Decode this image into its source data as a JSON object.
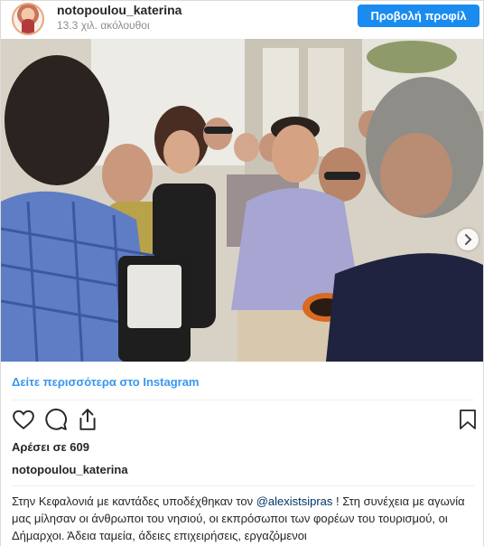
{
  "header": {
    "username": "notopoulou_katerina",
    "followers": "13.3 χιλ. ακόλουθοι",
    "profile_button": "Προβολή προφίλ"
  },
  "post": {
    "image_alt_icon": "photo",
    "carousel": {
      "slide_count": 4,
      "active_index": 0
    },
    "next_icon": "chevron-right-icon",
    "more_link": "Δείτε περισσότερα στο Instagram",
    "actions": [
      "heart-icon",
      "comment-icon",
      "share-icon",
      "bookmark-icon"
    ],
    "likes": "Αρέσει σε 609",
    "caption_user": "notopoulou_katerina",
    "caption": {
      "part1": "Στην Κεφαλονιά με καντάδες υποδέχθηκαν τον ",
      "mention": "@alexistsipras",
      "part2": " ! Στη συνέχεια με αγωνία μας μίλησαν οι άνθρωποι του νησιού, οι εκπρόσωποι των φορέων του τουρισμού, οι Δήμαρχοι. Άδεια ταμεία, άδειες επιχειρήσεις, εργαζόμενοι"
    }
  },
  "colors": {
    "accent": "#3897f0",
    "button": "#1a8cf0",
    "mention": "#003569"
  }
}
